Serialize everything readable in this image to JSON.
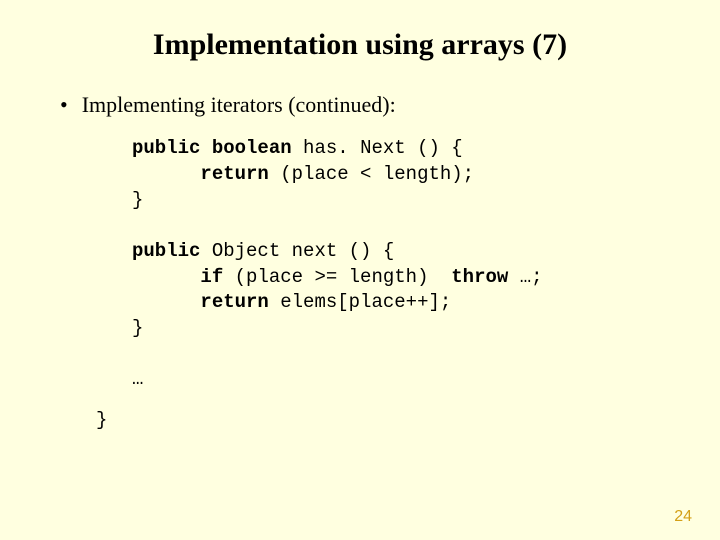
{
  "title": "Implementation using arrays (7)",
  "bullet": {
    "dot": "•",
    "text": "Implementing iterators (continued):"
  },
  "code": {
    "l1a": "public",
    "l1b": " ",
    "l1c": "boolean",
    "l1d": " has. Next () {",
    "l2a": "      ",
    "l2b": "return",
    "l2c": " (place < length);",
    "l3": "}",
    "blank1": "",
    "l4a": "public",
    "l4b": " Object next () {",
    "l5a": "      ",
    "l5b": "if",
    "l5c": " (place >= length)  ",
    "l5d": "throw",
    "l5e": " …;",
    "l6a": "      ",
    "l6b": "return",
    "l6c": " elems[place++];",
    "l7": "}",
    "blank2": "",
    "l8": "…"
  },
  "closer": "}",
  "pagenum": "24"
}
